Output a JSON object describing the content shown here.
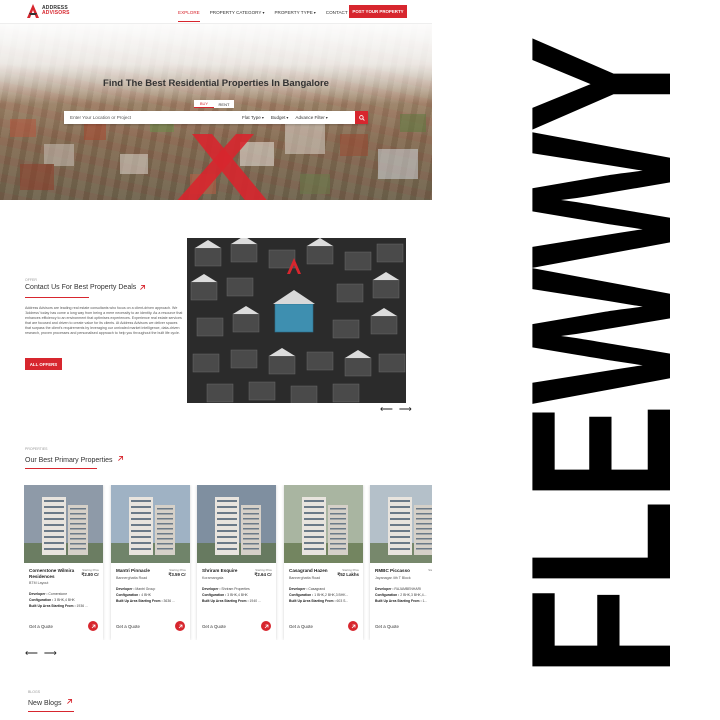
{
  "header": {
    "logo_line1": "ADDRESS",
    "logo_line2": "ADVISORS",
    "nav": [
      {
        "label": "EXPLORE",
        "active": true,
        "caret": false
      },
      {
        "label": "PROPERTY CATEGORY",
        "active": false,
        "caret": true
      },
      {
        "label": "PROPERTY TYPE",
        "active": false,
        "caret": true
      },
      {
        "label": "CONTACT",
        "active": false,
        "caret": false
      }
    ],
    "post_button": "POST YOUR PROPERTY"
  },
  "hero": {
    "title": "Find The Best Residential Properties In Bangalore",
    "tabs": [
      "BUY",
      "RENT"
    ],
    "active_tab": "BUY",
    "search_placeholder": "Enter Your Location or Project",
    "filters": [
      "Flat Type",
      "Budget",
      "Advance Filter"
    ]
  },
  "contact": {
    "small_label": "OFFER",
    "title": "Contact Us For Best Property Deals",
    "paragraph": "Address Advisors are leading real estate consultants who focus on a client-driven approach. We 'Address' today has come a long way from being a mere necessity to an identity. As a resource that enhances efficiency to an environment that optimises experiences. Experience real estate services that are focused and driven to create value for its clients. At Address Advisors we deliver spaces that surpass the client's requirements by leveraging our unrivaled market intelligence, data-driven research, proven processes and personalised approach to help you throughout the built life cycle.",
    "button": "ALL OFFERS"
  },
  "properties": {
    "small_label": "PROPERTIES",
    "title": "Our Best Primary Properties",
    "price_label": "Starting Price",
    "quote_label": "Get a Quote",
    "items": [
      {
        "name": "Cornerstone Wilmira Residences",
        "location": "BTM Layout",
        "price": "₹2.80 Cr",
        "developer": "Cornerstone",
        "configuration": "3 BHK,4 BHK",
        "area": "1936 ...",
        "img": "#8e9aa8"
      },
      {
        "name": "Mantri Pinnacle",
        "location": "Bannerghatta Road",
        "price": "₹3.59 Cr",
        "developer": "Mantri Group",
        "configuration": "4 BHK",
        "area": "3636 ...",
        "img": "#9fb2c4"
      },
      {
        "name": "Shriram Esquire",
        "location": "Koramangala",
        "price": "₹2.64 Cr",
        "developer": "Shriram Properties",
        "configuration": "3 BHK,4 BHK",
        "area": "1940 ...",
        "img": "#7f8fa0"
      },
      {
        "name": "Casagrand Hazen",
        "location": "Bannerghatta Road",
        "price": "₹52 Lakhs",
        "developer": "Casagrand",
        "configuration": "1 BHK,2 BHK,3 BHK...",
        "area": "603 S...",
        "img": "#a9b5a1"
      },
      {
        "name": "RMBC Piccasso",
        "location": "Jayanagar 4th T Block",
        "price": "₹",
        "developer": "RAJAMBENHARI",
        "configuration": "2 BHK,3 BHK,4...",
        "area": "1...",
        "img": "#b4c0c9"
      }
    ],
    "labels": {
      "developer": "Developer :",
      "configuration": "Configuration :",
      "area": "Built Up Area Starting From :"
    }
  },
  "blogs": {
    "small_label": "BLOGS",
    "title": "New Blogs"
  },
  "brand": {
    "text": "FLEWWY"
  },
  "colors": {
    "accent": "#d7262e"
  }
}
